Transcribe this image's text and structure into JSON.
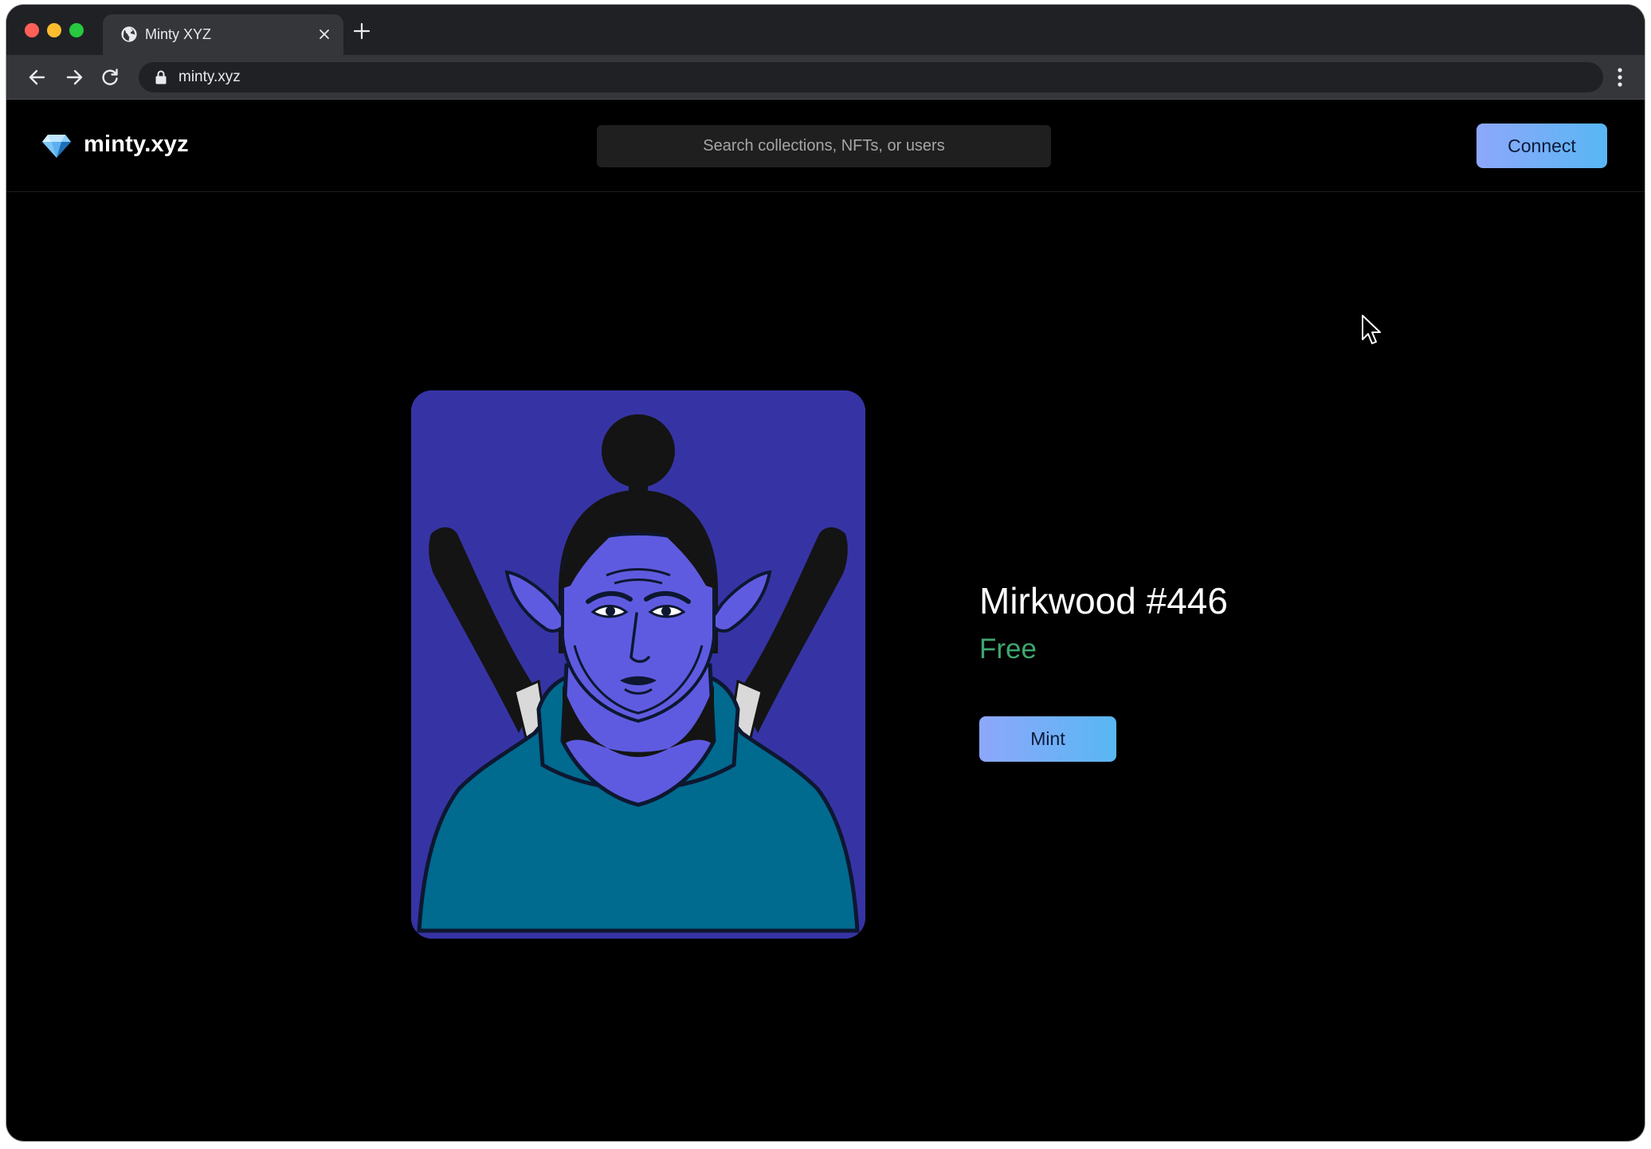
{
  "browser": {
    "tab_title": "Minty XYZ",
    "url": "minty.xyz",
    "icons": [
      "globe-icon",
      "close-icon",
      "plus-icon",
      "back-arrow-icon",
      "forward-arrow-icon",
      "reload-icon",
      "lock-icon",
      "kebab-menu-icon"
    ]
  },
  "header": {
    "logo_text": "minty.xyz",
    "logo_icon": "diamond-icon",
    "search_placeholder": "Search collections, NFTs, or users",
    "search_value": "",
    "connect_label": "Connect"
  },
  "nft": {
    "title": "Mirkwood #446",
    "price": "Free",
    "mint_label": "Mint",
    "image": "elf-character-illustration"
  },
  "colors": {
    "page_background": "#000000",
    "button_gradient_start": "#8ea7fb",
    "button_gradient_end": "#58b7f3",
    "price_color": "#3fa66e",
    "art_background": "#3634a4",
    "art_skin": "#5f5be0",
    "art_cloak": "#016a8f"
  }
}
